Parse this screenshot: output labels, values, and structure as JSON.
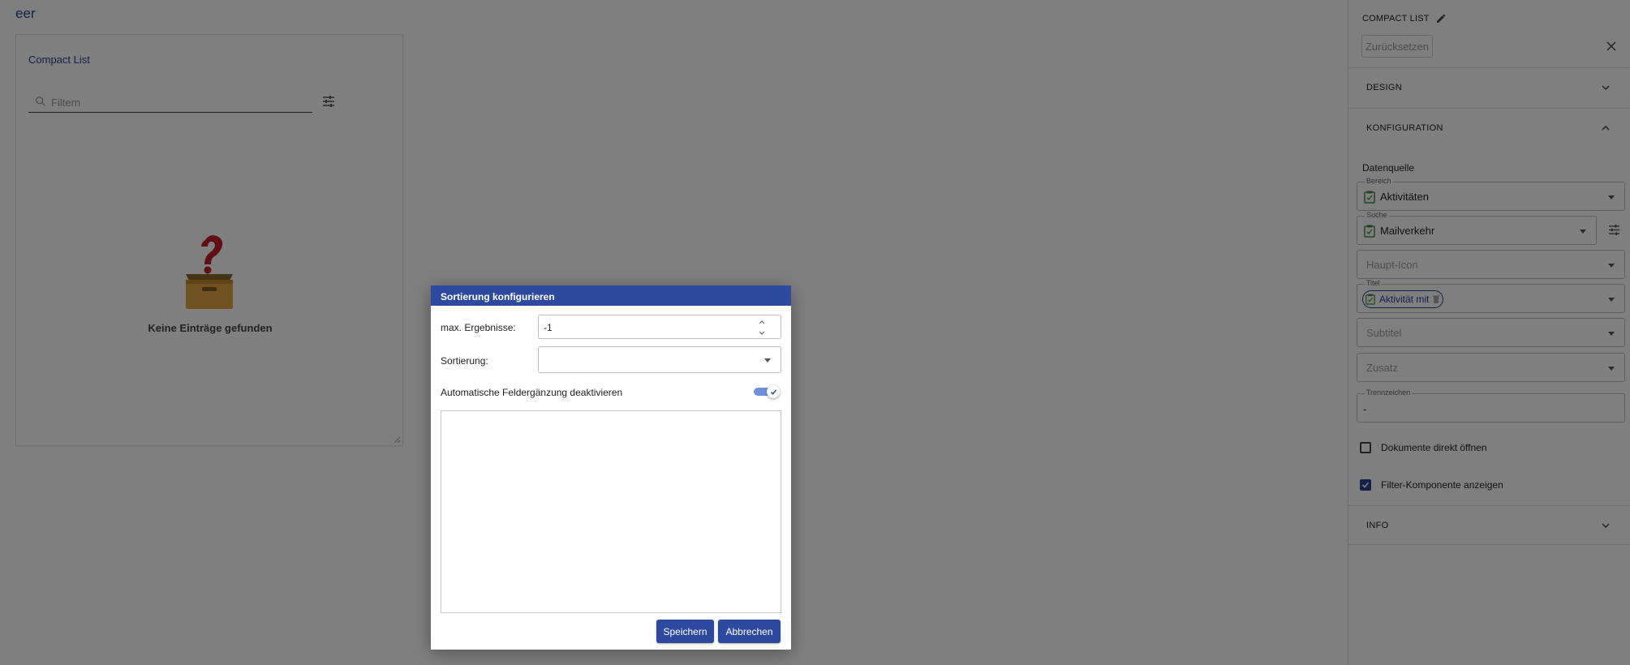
{
  "page": {
    "title": "eer",
    "card_title": "Compact List",
    "filter_placeholder": "Filtern",
    "empty_text": "Keine Einträge gefunden"
  },
  "side_panel": {
    "title": "COMPACT LIST",
    "reset_label": "Zurücksetzen",
    "sections": {
      "design": "DESIGN",
      "konfiguration": "KONFIGURATION",
      "info": "INFO"
    },
    "datenquelle_label": "Datenquelle",
    "fields": {
      "bereich": {
        "label": "Bereich",
        "value": "Aktivitäten"
      },
      "suche": {
        "label": "Suche",
        "value": "Mailverkehr"
      },
      "haupt_icon": {
        "placeholder": "Haupt-Icon"
      },
      "titel": {
        "label": "Titel",
        "chip": "Aktivität mit"
      },
      "subtitel": {
        "placeholder": "Subtitel"
      },
      "zusatz": {
        "placeholder": "Zusatz"
      },
      "trennzeichen": {
        "label": "Trennzeichen",
        "value": "-"
      }
    },
    "checkboxes": {
      "dokumente": {
        "label": "Dokumente direkt öffnen",
        "checked": false
      },
      "filter": {
        "label": "Filter-Komponente anzeigen",
        "checked": true
      }
    }
  },
  "dialog": {
    "title": "Sortierung konfigurieren",
    "max_label": "max. Ergebnisse:",
    "max_value": "-1",
    "sort_label": "Sortierung:",
    "sort_value": "",
    "auto_label": "Automatische Feldergänzung deaktivieren",
    "auto_enabled": true,
    "textarea_value": "",
    "save_label": "Speichern",
    "cancel_label": "Abbrechen"
  },
  "colors": {
    "accent": "#2e4aa0",
    "link": "#2a3f8f",
    "overlay": "rgba(0,0,0,0.5)"
  }
}
